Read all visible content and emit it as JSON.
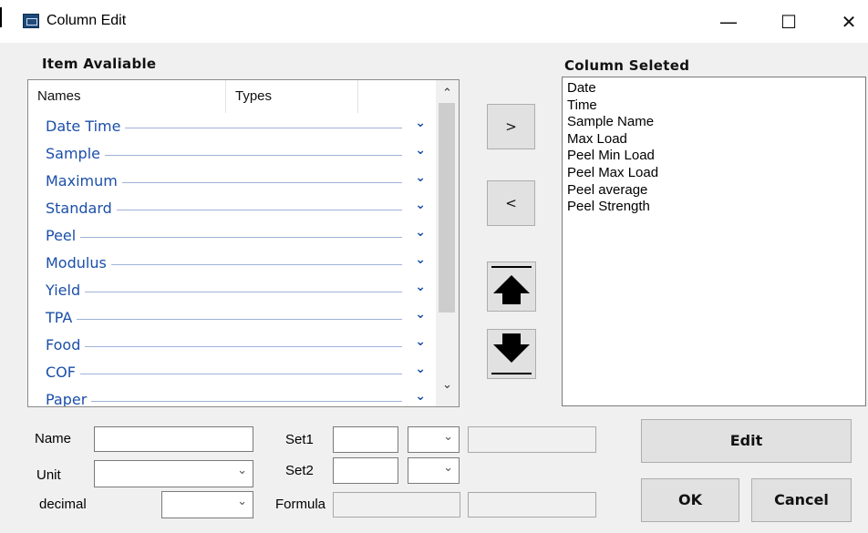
{
  "window": {
    "title": "Column Edit",
    "minimize": "—",
    "maximize": "☐",
    "close": "✕"
  },
  "available": {
    "label": "Item Avaliable",
    "columns": [
      "Names",
      "Types"
    ],
    "items": [
      "Date Time",
      "Sample",
      "Maximum",
      "Standard",
      "Peel",
      "Modulus",
      "Yield",
      "TPA",
      "Food",
      "COF",
      "Paper"
    ],
    "scroll_up": "⌃",
    "scroll_down": "⌄"
  },
  "selected": {
    "label": "Column Seleted",
    "items": [
      "Date",
      "Time",
      "Sample Name",
      "Max Load",
      "Peel Min Load",
      "Peel Max Load",
      "Peel average",
      "Peel Strength"
    ]
  },
  "buttons": {
    "add": ">",
    "remove": "<",
    "edit": "Edit",
    "ok": "OK",
    "cancel": "Cancel"
  },
  "form": {
    "name_label": "Name",
    "name_value": "",
    "unit_label": "Unit",
    "unit_value": "",
    "decimal_label": "decimal",
    "decimal_value": "",
    "set1_label": "Set1",
    "set1_value": "",
    "set2_label": "Set2",
    "set2_value": "",
    "formula_label": "Formula",
    "formula_value": ""
  },
  "icons": {
    "move_up": "up-arrow-icon",
    "move_down": "down-arrow-icon",
    "dropdown": "chevron-down-icon"
  },
  "colors": {
    "item_text": "#1b4fa8",
    "window_bg": "#f0f0f0",
    "button_bg": "#e1e1e1"
  }
}
